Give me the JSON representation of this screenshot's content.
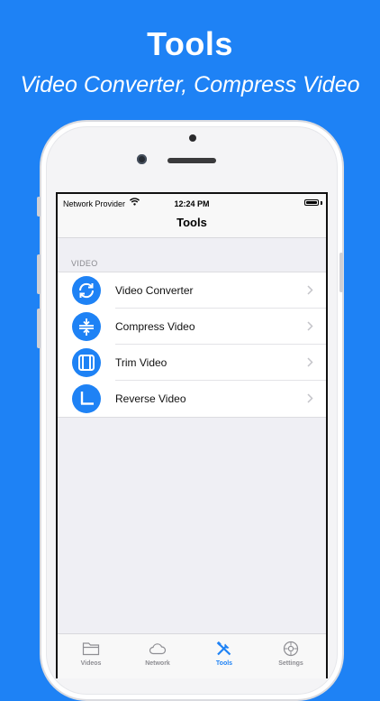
{
  "headline": "Tools",
  "subheadline": "Video Converter, Compress Video",
  "status_bar": {
    "carrier": "Network Provider",
    "time": "12:24 PM"
  },
  "nav": {
    "title": "Tools"
  },
  "section": {
    "header": "VIDEO"
  },
  "items": [
    {
      "label": "Video Converter",
      "icon": "convert-arrows-icon"
    },
    {
      "label": "Compress Video",
      "icon": "compress-icon"
    },
    {
      "label": "Trim Video",
      "icon": "trim-icon"
    },
    {
      "label": "Reverse Video",
      "icon": "reverse-clock-icon"
    }
  ],
  "tabs": [
    {
      "label": "Videos",
      "icon": "folder-icon",
      "active": false
    },
    {
      "label": "Network",
      "icon": "cloud-icon",
      "active": false
    },
    {
      "label": "Tools",
      "icon": "tools-icon",
      "active": true
    },
    {
      "label": "Settings",
      "icon": "gear-icon",
      "active": false
    }
  ],
  "colors": {
    "accent": "#1E82F5",
    "background": "#1E82F5",
    "inactive_tab": "#8e8e93"
  }
}
